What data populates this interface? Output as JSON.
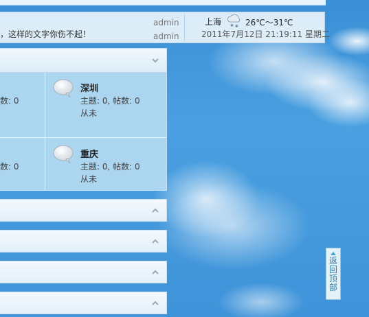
{
  "infobar": {
    "notice": "，这样的文字你伤不起！",
    "user1": "admin",
    "user2": "admin"
  },
  "weather": {
    "city": "上海",
    "icon": "snow-cloud-icon",
    "temperature": "26℃～31℃",
    "datetime": "2011年7月12日 21:19:11 星期二"
  },
  "category": {
    "left_stats": [
      "数: 0",
      "数: 0"
    ],
    "forums": [
      {
        "name": "深圳",
        "stats": "主题: 0, 帖数: 0",
        "last_post": "从未"
      },
      {
        "name": "重庆",
        "stats": "主题: 0, 帖数: 0",
        "last_post": "从未"
      }
    ]
  },
  "back_to_top": {
    "label": "返回顶部"
  },
  "colors": {
    "sky": "#3a8fd6",
    "panel": "#b7dbf2",
    "header": "#e3f0f9",
    "accent": "#2f7a9f"
  }
}
